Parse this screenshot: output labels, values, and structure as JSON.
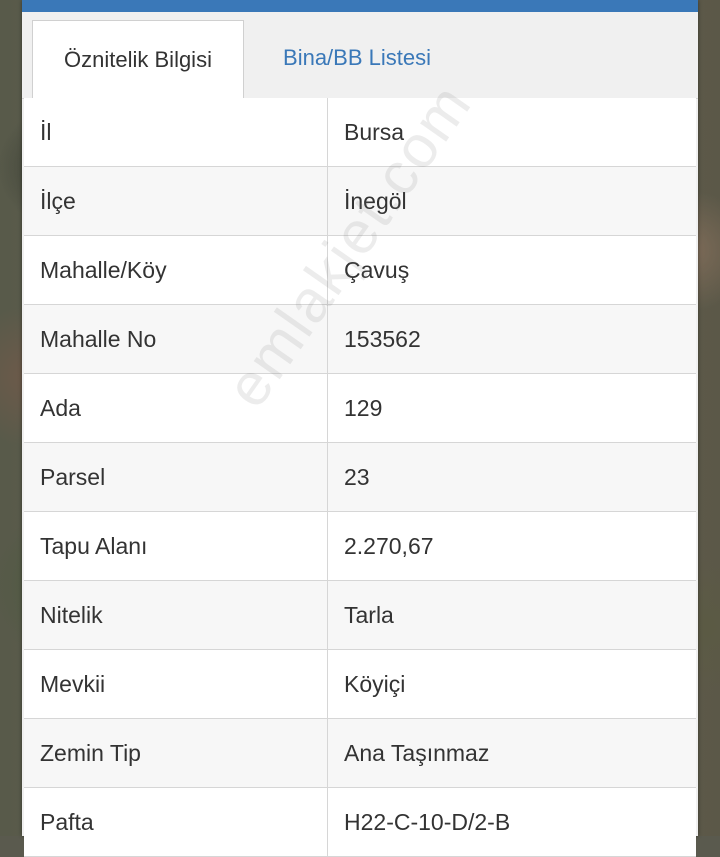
{
  "tabs": [
    {
      "label": "Öznitelik Bilgisi",
      "active": true
    },
    {
      "label": "Bina/BB Listesi",
      "active": false
    }
  ],
  "rows": [
    {
      "key": "İl",
      "value": "Bursa"
    },
    {
      "key": "İlçe",
      "value": "İnegöl"
    },
    {
      "key": "Mahalle/Köy",
      "value": "Çavuş"
    },
    {
      "key": "Mahalle No",
      "value": "153562"
    },
    {
      "key": "Ada",
      "value": "129"
    },
    {
      "key": "Parsel",
      "value": "23"
    },
    {
      "key": "Tapu Alanı",
      "value": "2.270,67"
    },
    {
      "key": "Nitelik",
      "value": "Tarla"
    },
    {
      "key": "Mevkii",
      "value": "Köyiçi"
    },
    {
      "key": "Zemin Tip",
      "value": "Ana Taşınmaz"
    },
    {
      "key": "Pafta",
      "value": "H22-C-10-D/2-B"
    }
  ],
  "watermark": "emlakjet.com",
  "colors": {
    "accent": "#3a78b8",
    "text": "#333333"
  }
}
